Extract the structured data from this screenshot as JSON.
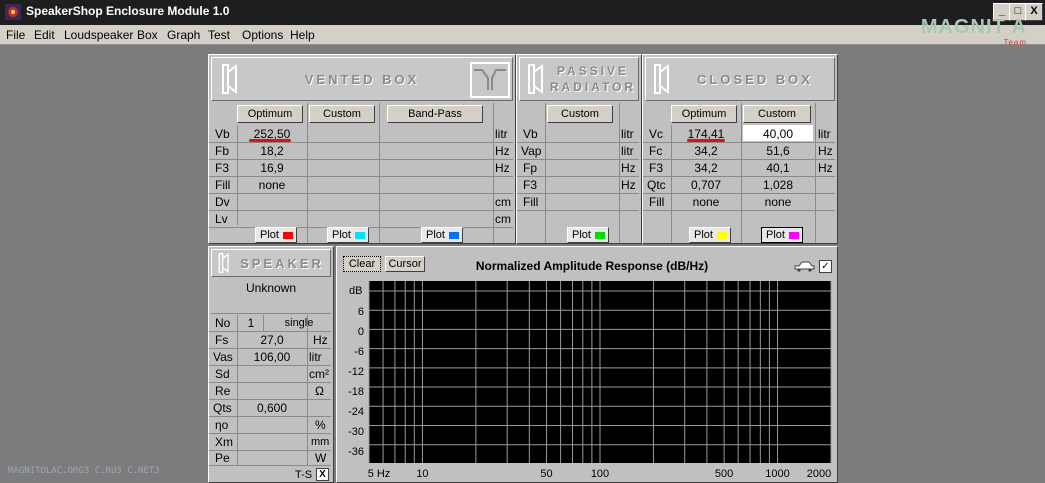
{
  "window": {
    "title": "SpeakerShop Enclosure Module 1.0",
    "minimize": "_",
    "maximize": "□",
    "close": "X"
  },
  "menu": [
    "File",
    "Edit",
    "Loudspeaker",
    "Box",
    "Graph",
    "Test",
    "Options",
    "Help"
  ],
  "logo": {
    "text": "MAGNIT A",
    "sub": "Team"
  },
  "watermark": "MAGNITOLAC.ORG3 C.RU3 C.NET3",
  "vented": {
    "title": "VENTED BOX",
    "buttons": [
      "Optimum",
      "Custom",
      "Band-Pass"
    ],
    "rows": [
      {
        "label": "Vb",
        "opt": "252,50",
        "unit": "litr"
      },
      {
        "label": "Fb",
        "opt": "18,2",
        "unit": "Hz"
      },
      {
        "label": "F3",
        "opt": "16,9",
        "unit": "Hz"
      },
      {
        "label": "Fill",
        "opt": "none",
        "unit": ""
      },
      {
        "label": "Dv",
        "opt": "",
        "unit": "cm"
      },
      {
        "label": "Lv",
        "opt": "",
        "unit": "cm"
      }
    ],
    "plot": "Plot",
    "plot_colors": [
      "#ff0000",
      "#00e5ff",
      "#0070ff"
    ]
  },
  "passive": {
    "title_line1": "PASSIVE",
    "title_line2": "RADIATOR",
    "button": "Custom",
    "rows": [
      {
        "label": "Vb",
        "unit": "litr"
      },
      {
        "label": "Vap",
        "unit": "litr"
      },
      {
        "label": "Fp",
        "unit": "Hz"
      },
      {
        "label": "F3",
        "unit": "Hz"
      },
      {
        "label": "Fill",
        "unit": ""
      }
    ],
    "plot": "Plot",
    "plot_color": "#00e000"
  },
  "closed": {
    "title": "CLOSED BOX",
    "buttons": [
      "Optimum",
      "Custom"
    ],
    "rows": [
      {
        "label": "Vc",
        "opt": "174,41",
        "custom": "40,00",
        "unit": "litr"
      },
      {
        "label": "Fc",
        "opt": "34,2",
        "custom": "51,6",
        "unit": "Hz"
      },
      {
        "label": "F3",
        "opt": "34,2",
        "custom": "40,1",
        "unit": "Hz"
      },
      {
        "label": "Qtc",
        "opt": "0,707",
        "custom": "1,028",
        "unit": ""
      },
      {
        "label": "Fill",
        "opt": "none",
        "custom": "none",
        "unit": ""
      }
    ],
    "plot": "Plot",
    "plot_colors": [
      "#ffff00",
      "#ff00ff"
    ]
  },
  "speaker": {
    "title": "SPEAKER",
    "name": "Unknown",
    "rows": [
      {
        "label": "No",
        "value": "1",
        "extra": "single",
        "unit": ""
      },
      {
        "label": "Fs",
        "value": "27,0",
        "unit": "Hz"
      },
      {
        "label": "Vas",
        "value": "106,00",
        "unit": "litr"
      },
      {
        "label": "Sd",
        "value": "",
        "unit": "cm²"
      },
      {
        "label": "Re",
        "value": "",
        "unit": "Ω"
      },
      {
        "label": "Qts",
        "value": "0,600",
        "unit": ""
      },
      {
        "label": "ηo",
        "value": "",
        "unit": "%"
      },
      {
        "label": "Xm",
        "value": "",
        "unit": "mm"
      },
      {
        "label": "Pe",
        "value": "",
        "unit": "W"
      }
    ],
    "ts_label": "T-S",
    "ts_checked": "X"
  },
  "graph": {
    "clear": "Clear",
    "cursor": "Cursor",
    "title": "Normalized Amplitude Response (dB/Hz)",
    "check": "✓",
    "y_unit": "dB",
    "y_labels": [
      "6",
      "0",
      "-6",
      "-12",
      "-18",
      "-24",
      "-30",
      "-36"
    ],
    "x_labels": [
      "5 Hz",
      "10",
      "50",
      "100",
      "500",
      "1000",
      "2000"
    ]
  }
}
